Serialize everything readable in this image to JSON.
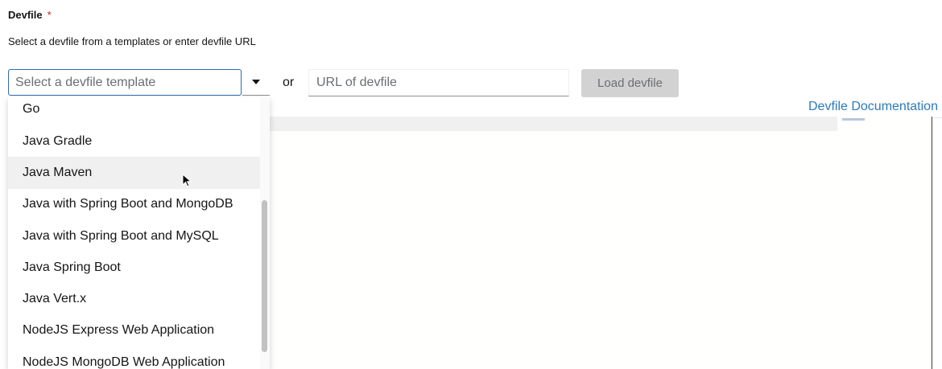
{
  "form": {
    "label": "Devfile",
    "required_mark": "*",
    "helper_text": "Select a devfile from a templates or enter devfile URL"
  },
  "select": {
    "placeholder": "Select a devfile template",
    "toggle_icon": "caret-down-icon"
  },
  "separator_text": "or",
  "url_input": {
    "placeholder": "URL of devfile",
    "value": ""
  },
  "load_button": {
    "label": "Load devfile",
    "disabled": true
  },
  "doc_link": {
    "label": "Devfile Documentation"
  },
  "dropdown": {
    "items": [
      {
        "label": "Go"
      },
      {
        "label": "Java Gradle"
      },
      {
        "label": "Java Maven"
      },
      {
        "label": "Java with Spring Boot and MongoDB"
      },
      {
        "label": "Java with Spring Boot and MySQL"
      },
      {
        "label": "Java Spring Boot"
      },
      {
        "label": "Java Vert.x"
      },
      {
        "label": "NodeJS Express Web Application"
      },
      {
        "label": "NodeJS MongoDB Web Application"
      }
    ],
    "hovered_index": 2
  },
  "colors": {
    "accent": "#2b6cb0",
    "link": "#2b7bbf",
    "required": "#c9190b",
    "disabled_button": "#d2d2d2",
    "hover_row": "#f0f0f0"
  }
}
